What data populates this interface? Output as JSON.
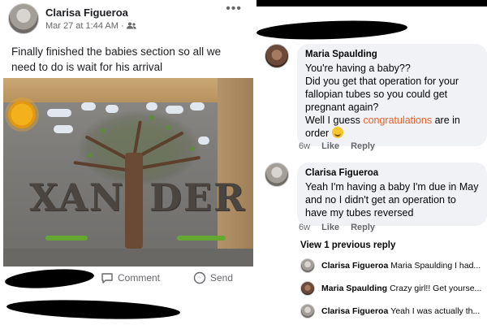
{
  "post": {
    "author": "Clarisa Figueroa",
    "timestamp": "Mar 27 at 1:44 AM",
    "audience_icon": "friends-icon",
    "more_icon": "more-dots-icon",
    "text": "Finally finished the babies section so all  we\nneed  to do is  wait for his arrival",
    "mural_text_left": "XAN",
    "mural_text_right": "DER",
    "actions": {
      "comment_label": "Comment",
      "send_label": "Send"
    }
  },
  "comments": [
    {
      "author": "Maria Spaulding",
      "text_before": "You're having a baby??\n  Did you get that operation for your fallopian tubes so you could get pregnant again?\n  Well I guess ",
      "highlight": "congratulations",
      "text_after": " are in order ",
      "emoji": "grinning-face-emoji",
      "age": "6w",
      "like_label": "Like",
      "reply_label": "Reply"
    },
    {
      "author": "Clarisa Figueroa",
      "text": "Yeah I'm having a baby I'm due in May  and no I didn't get an operation to have my tubes  reversed",
      "age": "6w",
      "like_label": "Like",
      "reply_label": "Reply"
    }
  ],
  "view_previous_label": "View 1 previous reply",
  "replies": [
    {
      "author": "Clarisa Figueroa",
      "preview": "Maria Spaulding I had..."
    },
    {
      "author": "Maria Spaulding",
      "preview": "Crazy girl!! Get yourse..."
    },
    {
      "author": "Clarisa Figueroa",
      "preview": "Yeah I was actually th..."
    }
  ],
  "colors": {
    "highlight": "#e4612b",
    "bubble_bg": "#f0f2f5",
    "meta_text": "#65676b"
  }
}
